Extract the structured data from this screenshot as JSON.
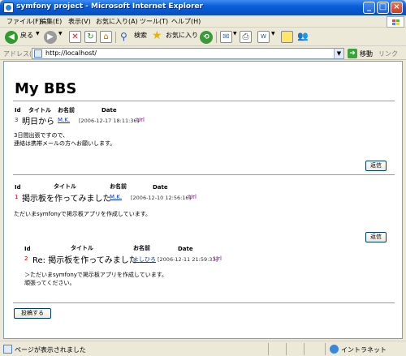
{
  "window": {
    "title": "symfony project - Microsoft Internet Explorer"
  },
  "menu": [
    "ファイル(F)",
    "編集(E)",
    "表示(V)",
    "お気に入り(A)",
    "ツール(T)",
    "ヘルプ(H)"
  ],
  "toolbar": {
    "back": "戻る",
    "search": "検索",
    "favorites": "お気に入り"
  },
  "address": {
    "label": "アドレス(D)",
    "url": "http://localhost/",
    "go": "移動",
    "links": "リンク"
  },
  "page": {
    "title": "My BBS",
    "headers": {
      "id": "Id",
      "subject": "タイトル",
      "name": "お名前",
      "date": "Date"
    },
    "posts": [
      {
        "id": "3",
        "subject": "明日から",
        "name": "M.K.",
        "date": "[2006-12-17 18:11:36]",
        "url": "Url",
        "body1": "3日間出張ですので、",
        "body2": "連絡は携帯メールの方へお願いします。"
      },
      {
        "id": "1",
        "subject": "掲示板を作ってみました",
        "name": "M.K.",
        "date": "[2006-12-10 12:56:16]",
        "url": "Url",
        "body1": "ただいまsymfonyで掲示板アプリを作成しています。"
      },
      {
        "id": "2",
        "subject": "Re: 掲示板を作ってみました",
        "name": "よしひろ",
        "date": "[2006-12-11 21:59:33]",
        "url": "Url",
        "body1": "＞ただいまsymfonyで掲示板アプリを作成しています。",
        "body2": "頑張ってください。"
      }
    ],
    "reply_label": "返信",
    "post_label": "投稿する"
  },
  "status": {
    "text": "ページが表示されました",
    "zone": "イントラネット"
  }
}
